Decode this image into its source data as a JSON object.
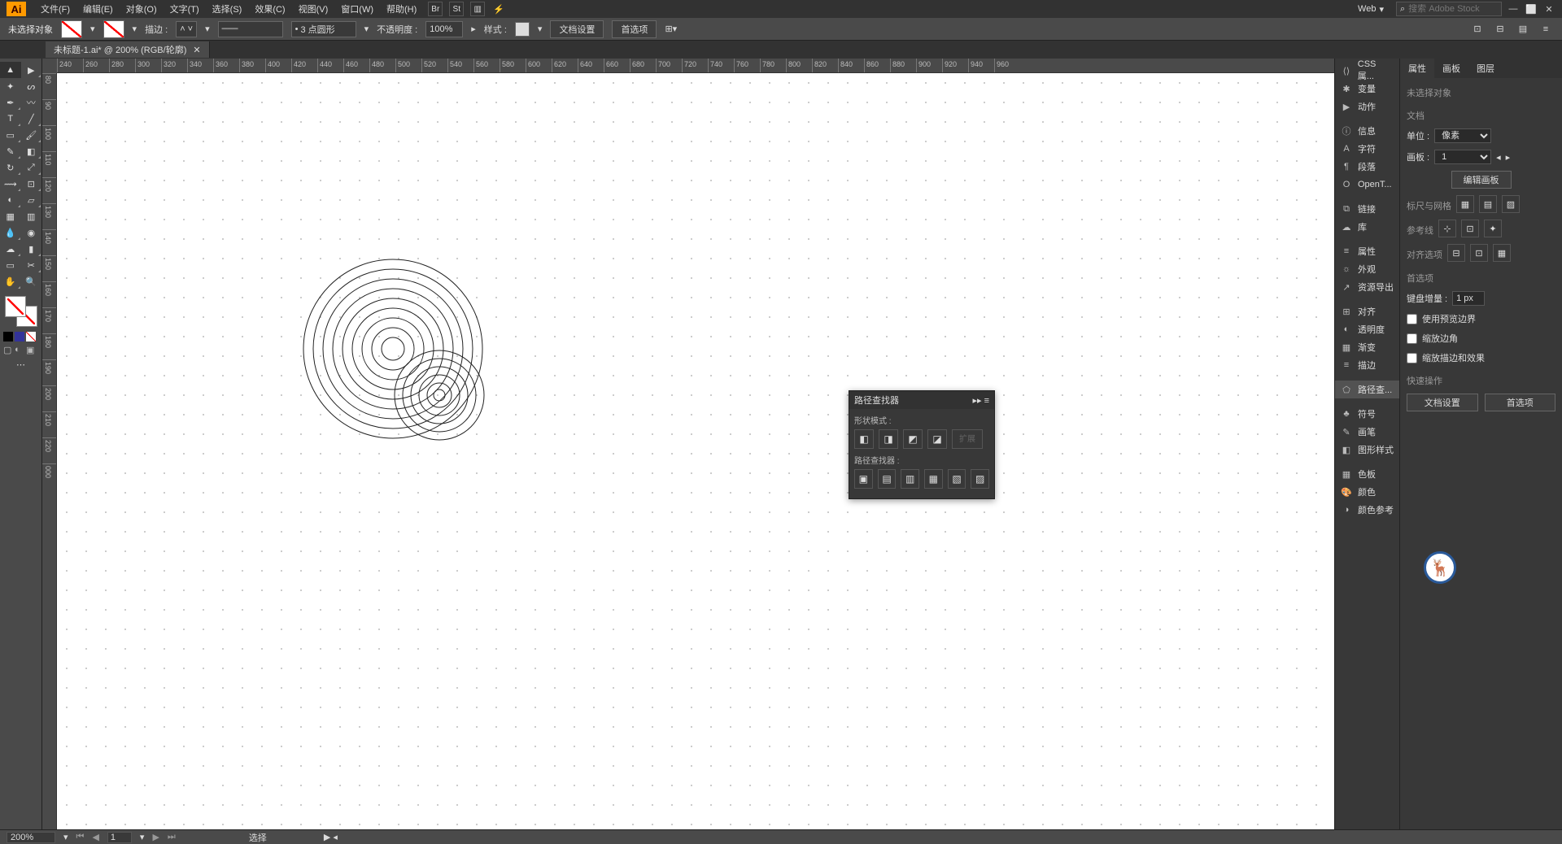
{
  "app": {
    "logo": "Ai"
  },
  "menu": {
    "items": [
      "文件(F)",
      "编辑(E)",
      "对象(O)",
      "文字(T)",
      "选择(S)",
      "效果(C)",
      "视图(V)",
      "窗口(W)",
      "帮助(H)"
    ]
  },
  "workspace": {
    "label": "Web"
  },
  "search": {
    "placeholder": "搜索 Adobe Stock"
  },
  "control": {
    "selection": "未选择对象",
    "stroke_label": "描边 :",
    "dash_value": "3 点圆形",
    "opacity_label": "不透明度 :",
    "opacity_value": "100%",
    "style_label": "样式 :",
    "doc_setup": "文档设置",
    "prefs": "首选项"
  },
  "tab": {
    "title": "未标题-1.ai* @ 200% (RGB/轮廓)"
  },
  "ruler_h": [
    "240",
    "260",
    "280",
    "300",
    "320",
    "340",
    "360",
    "380",
    "400",
    "420",
    "440",
    "460",
    "480",
    "500",
    "520",
    "540",
    "560",
    "580",
    "600",
    "620",
    "640",
    "660",
    "680",
    "700",
    "720",
    "740",
    "760",
    "780",
    "800",
    "820",
    "840",
    "860",
    "880",
    "900",
    "920",
    "940",
    "960"
  ],
  "ruler_v": [
    "80",
    "90",
    "100",
    "110",
    "120",
    "130",
    "140",
    "150",
    "160",
    "170",
    "180",
    "190",
    "200",
    "210",
    "220",
    "000"
  ],
  "right_panel": {
    "items": [
      {
        "label": "CSS 属...",
        "icon": "⟨⟩"
      },
      {
        "label": "变量",
        "icon": "✱"
      },
      {
        "label": "动作",
        "icon": "▶"
      },
      {
        "label": "信息",
        "icon": "ⓘ"
      },
      {
        "label": "字符",
        "icon": "A"
      },
      {
        "label": "段落",
        "icon": "¶"
      },
      {
        "label": "OpenT...",
        "icon": "O"
      },
      {
        "label": "链接",
        "icon": "⧉"
      },
      {
        "label": "库",
        "icon": "☁"
      },
      {
        "label": "属性",
        "icon": "≡"
      },
      {
        "label": "外观",
        "icon": "☼"
      },
      {
        "label": "资源导出",
        "icon": "↗"
      },
      {
        "label": "对齐",
        "icon": "⊞"
      },
      {
        "label": "透明度",
        "icon": "◐"
      },
      {
        "label": "渐变",
        "icon": "▦"
      },
      {
        "label": "描边",
        "icon": "≡"
      },
      {
        "label": "路径查...",
        "icon": "⬠"
      },
      {
        "label": "符号",
        "icon": "♣"
      },
      {
        "label": "画笔",
        "icon": "✎"
      },
      {
        "label": "图形样式",
        "icon": "◧"
      },
      {
        "label": "色板",
        "icon": "▦"
      },
      {
        "label": "颜色",
        "icon": "🎨"
      },
      {
        "label": "颜色参考",
        "icon": "◑"
      }
    ]
  },
  "props": {
    "tabs": [
      "属性",
      "画板",
      "图层"
    ],
    "no_selection": "未选择对象",
    "doc": "文档",
    "units_label": "单位 :",
    "units_value": "像素",
    "artboard_label": "画板 :",
    "artboard_value": "1",
    "edit_artboard": "编辑画板",
    "ruler_grid": "标尺与网格",
    "guides": "参考线",
    "align_opts": "对齐选项",
    "prefs_hdr": "首选项",
    "key_inc_label": "键盘增量 :",
    "key_inc_value": "1 px",
    "cb1": "使用预览边界",
    "cb2": "缩放边角",
    "cb3": "缩放描边和效果",
    "quick": "快速操作",
    "doc_setup": "文档设置",
    "prefs_btn": "首选项"
  },
  "pathfinder": {
    "title": "路径查找器",
    "shape_modes": "形状模式 :",
    "expand": "扩展",
    "pathfinders": "路径查找器 :"
  },
  "status": {
    "zoom": "200%",
    "artboard": "1",
    "tool": "选择"
  }
}
